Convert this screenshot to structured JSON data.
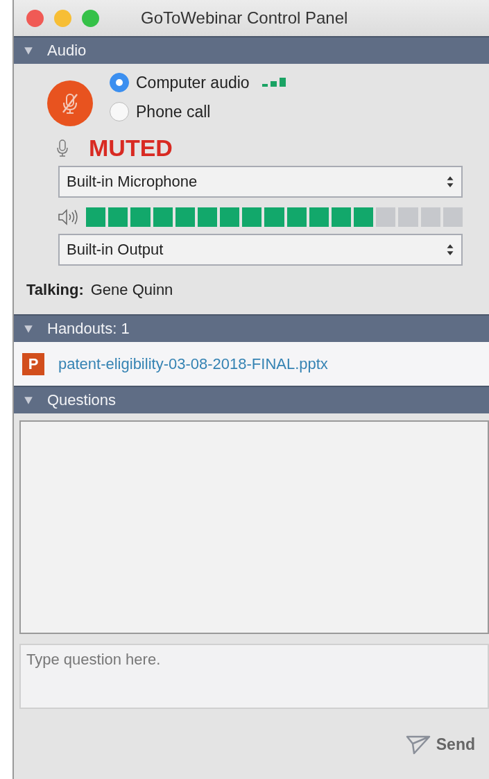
{
  "window": {
    "title": "GoToWebinar Control Panel"
  },
  "audio": {
    "header": "Audio",
    "expanded": true,
    "muted": true,
    "options": [
      {
        "label": "Computer audio",
        "selected": true
      },
      {
        "label": "Phone call",
        "selected": false
      }
    ],
    "status": "MUTED",
    "microphone": "Built-in Microphone",
    "speaker_level": {
      "level": 0.765
    },
    "output": "Built-in Output",
    "talking_label": "Talking:",
    "talking_name": "Gene Quinn"
  },
  "handouts": {
    "header": "Handouts: 1",
    "expanded": true,
    "files": [
      {
        "icon_letter": "P",
        "name": "patent-eligibility-03-08-2018-FINAL.pptx"
      }
    ]
  },
  "questions": {
    "header": "Questions",
    "expanded": true,
    "placeholder": "Type question here.",
    "send": "Send"
  }
}
